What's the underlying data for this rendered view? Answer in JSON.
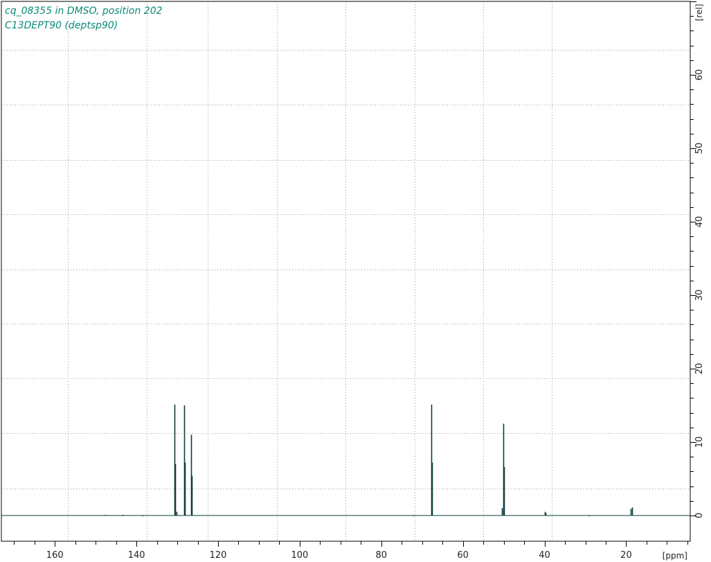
{
  "header": {
    "line1": "cq_08355 in DMSO, position 202",
    "line2": "C13DEPT90 (deptsp90)"
  },
  "colors": {
    "title": "#0a8a78",
    "trace": "#0b3d3a",
    "grid": "#9a9a9a",
    "frame": "#000000"
  },
  "chart_data": {
    "type": "line",
    "title": "cq_08355 in DMSO, position 202",
    "subtitle": "C13DEPT90 (deptsp90)",
    "xlabel": "[ppm]",
    "ylabel": "[rel]",
    "x_reversed": true,
    "xlim": [
      173.1,
      4.3
    ],
    "ylim": [
      -3.5,
      70
    ],
    "x_ticks": [
      160,
      140,
      120,
      100,
      80,
      60,
      40,
      20
    ],
    "x_tick_labels": [
      "160",
      "140",
      "120",
      "100",
      "80",
      "60",
      "40",
      "20"
    ],
    "y_ticks": [
      0,
      10,
      20,
      30,
      40,
      50,
      60
    ],
    "y_tick_labels": [
      "0",
      "10",
      "20",
      "30",
      "40",
      "50",
      "60"
    ],
    "x_grid": [
      156.8,
      137.4,
      122.5,
      105.6,
      88.8,
      71.9,
      55.0,
      38.2
    ],
    "y_grid": [
      3.7,
      11.2,
      18.7,
      26.1,
      33.5,
      41.0,
      48.4,
      55.9,
      63.4
    ],
    "grid": true,
    "baseline": 0,
    "peaks": [
      {
        "ppm": 130.7,
        "height": 15.1
      },
      {
        "ppm": 130.5,
        "height": 7.0
      },
      {
        "ppm": 128.3,
        "height": 15.0
      },
      {
        "ppm": 128.1,
        "height": 7.2
      },
      {
        "ppm": 126.6,
        "height": 11.0
      },
      {
        "ppm": 126.4,
        "height": 5.4
      },
      {
        "ppm": 130.1,
        "height": 0.5
      },
      {
        "ppm": 67.7,
        "height": 15.1
      },
      {
        "ppm": 67.6,
        "height": 7.2
      },
      {
        "ppm": 50.1,
        "height": 12.5
      },
      {
        "ppm": 49.9,
        "height": 6.6
      },
      {
        "ppm": 50.4,
        "height": 1.0
      },
      {
        "ppm": 39.9,
        "height": 0.5
      },
      {
        "ppm": 39.7,
        "height": 0.35
      },
      {
        "ppm": 18.9,
        "height": 0.9
      },
      {
        "ppm": 18.5,
        "height": 1.1
      },
      {
        "ppm": 147.7,
        "height": 0.1
      },
      {
        "ppm": 143.4,
        "height": 0.1
      },
      {
        "ppm": 138.5,
        "height": -0.1
      },
      {
        "ppm": 72.2,
        "height": -0.1
      },
      {
        "ppm": 29.1,
        "height": -0.1
      }
    ]
  }
}
